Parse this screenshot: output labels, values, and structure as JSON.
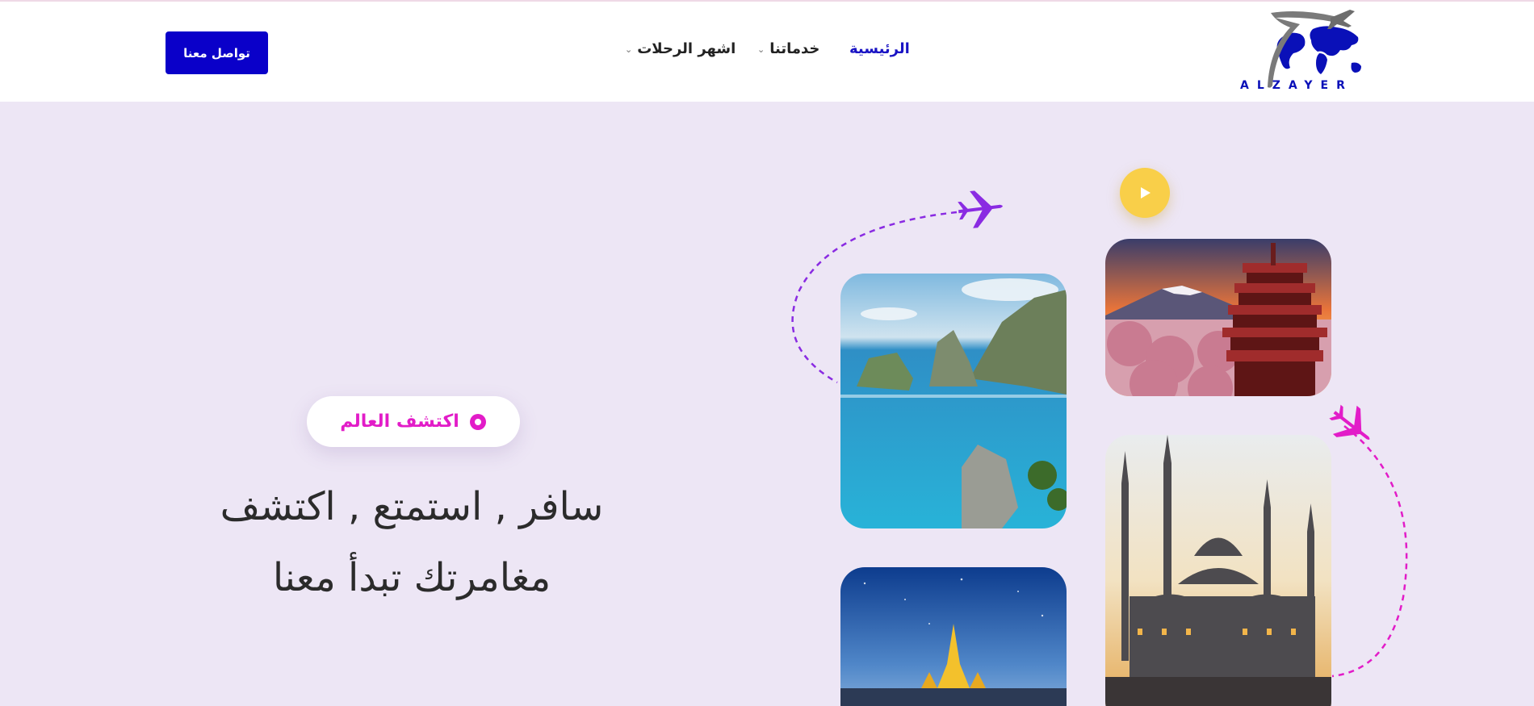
{
  "header": {
    "logo_text": "ALZAYER",
    "nav": [
      {
        "label": "الرئيسية",
        "active": true,
        "has_dropdown": false
      },
      {
        "label": "خدماتنا",
        "active": false,
        "has_dropdown": true
      },
      {
        "label": "اشهر الرحلات",
        "active": false,
        "has_dropdown": true
      }
    ],
    "contact_label": "تواصل معنا"
  },
  "hero": {
    "badge_label": "اكتشف العالم",
    "headline_line1": "سافر , استمتع , اكتشف",
    "headline_line2": "مغامرتك تبدأ معنا"
  },
  "colors": {
    "accent": "#0a00c9",
    "pink": "#e21cc8",
    "purple": "#8a2be2",
    "yellow": "#f9cf49",
    "background": "#ede6f5"
  },
  "icons": {
    "play": "play-icon",
    "plane_purple": "airplane-icon",
    "plane_pink": "airplane-icon",
    "badge": "globe-icon"
  }
}
